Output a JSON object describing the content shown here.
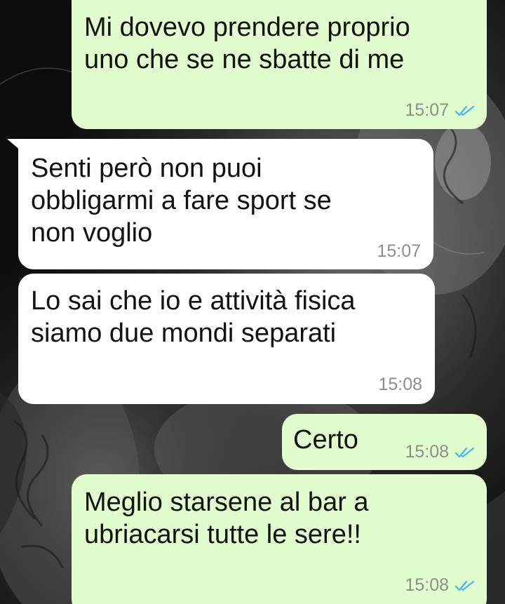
{
  "conversation": {
    "messages": [
      {
        "direction": "outgoing",
        "text": "Mi dovevo prendere proprio\nuno che se ne sbatte di me",
        "time": "15:07",
        "status": "read"
      },
      {
        "direction": "incoming",
        "text": "Senti però non puoi\nobbligarmi a fare sport se\nnon voglio",
        "time": "15:07"
      },
      {
        "direction": "incoming",
        "text": "Lo sai che io e attività fisica\nsiamo due mondi separati",
        "time": "15:08"
      },
      {
        "direction": "outgoing",
        "text": "Certo",
        "time": "15:08",
        "status": "read"
      },
      {
        "direction": "outgoing",
        "text": "Meglio starsene al bar a\nubriacarsi tutte le sere!!",
        "time": "15:08",
        "status": "read"
      }
    ]
  },
  "theme": {
    "outgoing_bubble": "#e2fdcd",
    "incoming_bubble": "#ffffff",
    "timestamp_color": "#8a8f8a",
    "read_tick_color": "#4fb6ec",
    "read_tick_icon": "double-check-icon"
  }
}
